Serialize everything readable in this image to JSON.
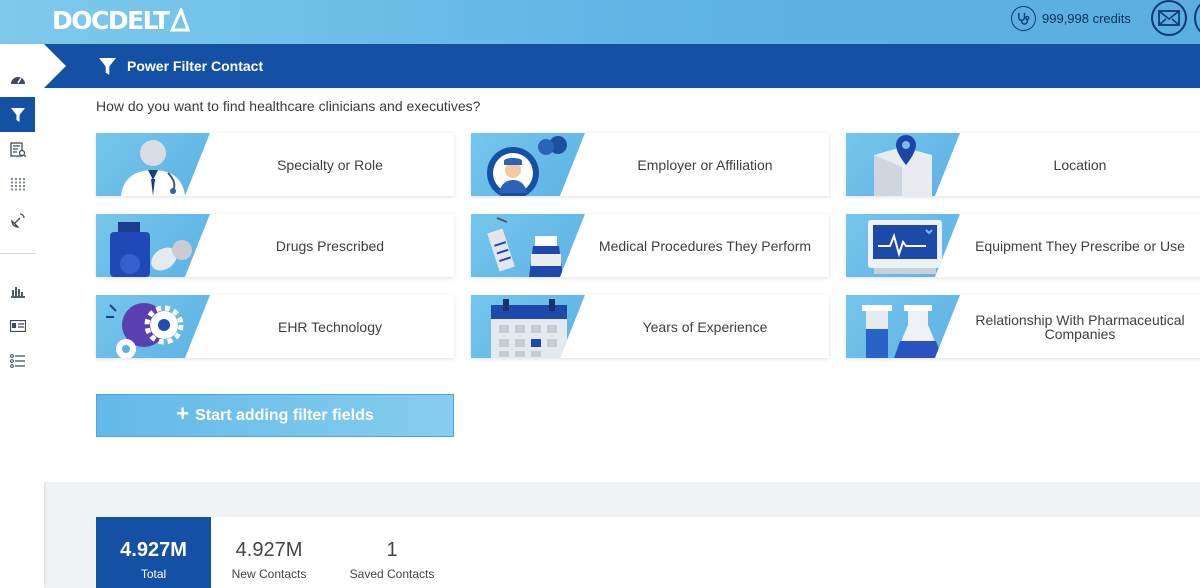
{
  "header": {
    "logo_text": "DOCDELT",
    "credits": "999,998 credits"
  },
  "page": {
    "title": "Power Filter Contact",
    "question": "How do you want to find healthcare clinicians and executives?"
  },
  "filters": [
    {
      "label": "Specialty or Role",
      "icon": "doctor-icon"
    },
    {
      "label": "Employer or Affiliation",
      "icon": "team-icon"
    },
    {
      "label": "Location",
      "icon": "location-pin-icon"
    },
    {
      "label": "Drugs Prescribed",
      "icon": "pill-bottle-icon"
    },
    {
      "label": "Medical Procedures They Perform",
      "icon": "syringe-icon"
    },
    {
      "label": "Equipment They Prescribe or Use",
      "icon": "monitor-icon"
    },
    {
      "label": "EHR Technology",
      "icon": "gears-icon"
    },
    {
      "label": "Years of Experience",
      "icon": "calendar-icon"
    },
    {
      "label": "Relationship With Pharmaceutical Companies",
      "icon": "flask-icon"
    }
  ],
  "add_button": "Start adding filter fields",
  "stats": [
    {
      "value": "4.927M",
      "label": "Total"
    },
    {
      "value": "4.927M",
      "label": "New Contacts"
    },
    {
      "value": "1",
      "label": "Saved Contacts"
    }
  ],
  "colors": {
    "primary": "#1451a5",
    "accent": "#5cb2e4",
    "header_dark": "#0d3a73"
  }
}
